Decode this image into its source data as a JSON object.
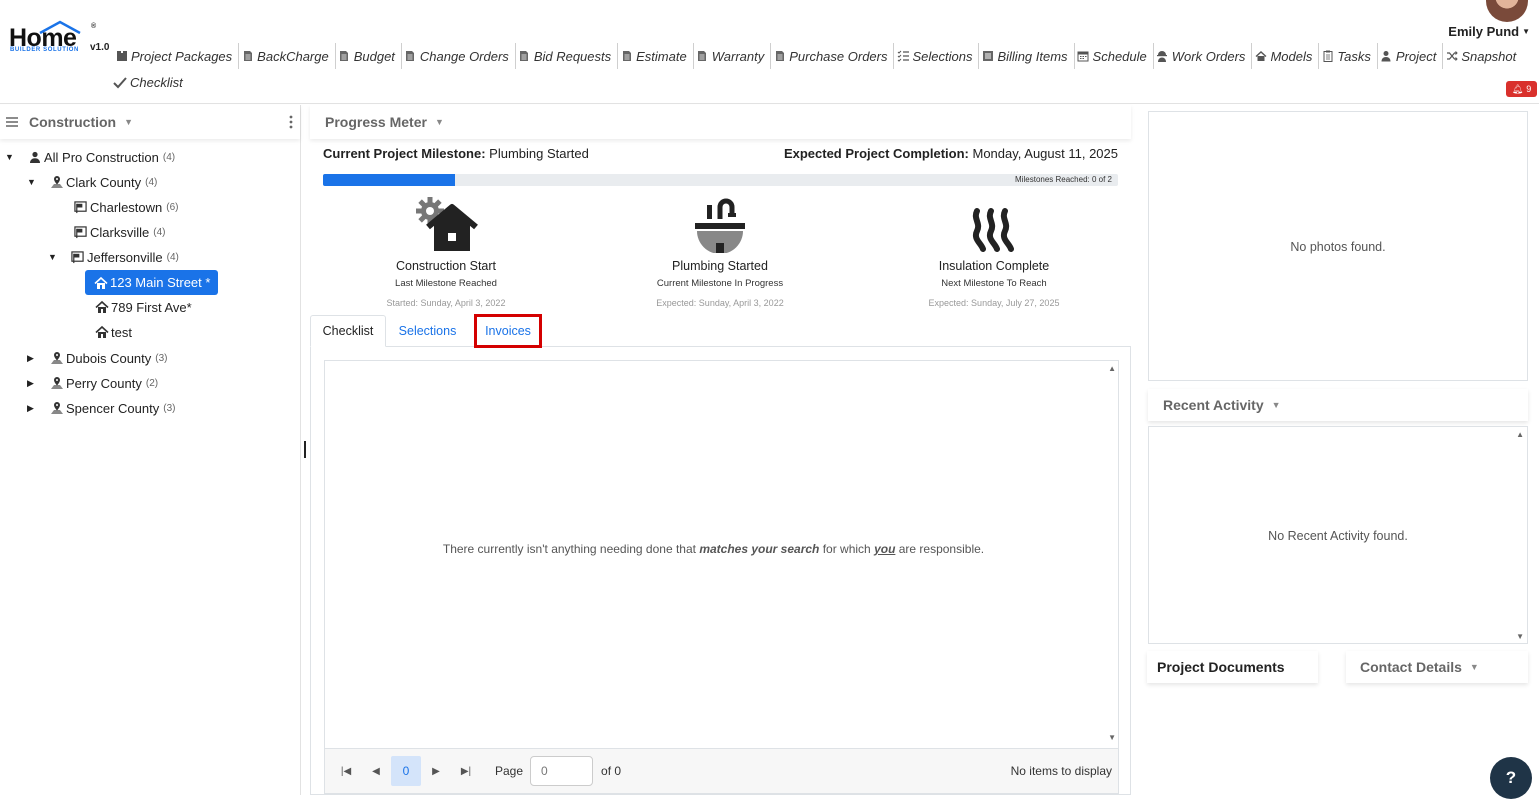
{
  "brand": {
    "logo_text": "Home",
    "tagline": "BUILDER SOLUTION",
    "version": "v1.0",
    "reg": "®"
  },
  "nav": {
    "items": [
      {
        "label": "Project Packages",
        "icon": "packages-icon"
      },
      {
        "label": "BackCharge",
        "icon": "document-icon"
      },
      {
        "label": "Budget",
        "icon": "document-icon"
      },
      {
        "label": "Change Orders",
        "icon": "document-icon"
      },
      {
        "label": "Bid Requests",
        "icon": "document-icon"
      },
      {
        "label": "Estimate",
        "icon": "document-icon"
      },
      {
        "label": "Warranty",
        "icon": "document-icon"
      },
      {
        "label": "Purchase Orders",
        "icon": "document-icon"
      },
      {
        "label": "Selections",
        "icon": "list-check-icon"
      },
      {
        "label": "Billing Items",
        "icon": "list-icon"
      },
      {
        "label": "Schedule",
        "icon": "calendar-icon"
      },
      {
        "label": "Work Orders",
        "icon": "worker-icon"
      },
      {
        "label": "Models",
        "icon": "house-icon"
      },
      {
        "label": "Tasks",
        "icon": "clipboard-icon"
      },
      {
        "label": "Project",
        "icon": "person-icon"
      },
      {
        "label": "Snapshot",
        "icon": "shuffle-icon"
      }
    ],
    "checklist": "Checklist"
  },
  "user": {
    "name": "Emily Pund",
    "notifications": "9"
  },
  "left": {
    "title": "Construction",
    "tree": [
      {
        "label": "All Pro Construction",
        "count": "(4)"
      },
      {
        "label": "Clark County",
        "count": "(4)"
      },
      {
        "label": "Charlestown",
        "count": "(6)"
      },
      {
        "label": "Clarksville",
        "count": "(4)"
      },
      {
        "label": "Jeffersonville",
        "count": "(4)"
      },
      {
        "label": "123 Main Street *",
        "count": ""
      },
      {
        "label": "789 First Ave*",
        "count": ""
      },
      {
        "label": "test",
        "count": ""
      },
      {
        "label": "Dubois County",
        "count": "(3)"
      },
      {
        "label": "Perry County",
        "count": "(2)"
      },
      {
        "label": "Spencer County",
        "count": "(3)"
      }
    ]
  },
  "progress": {
    "title": "Progress Meter",
    "current_label": "Current Project Milestone:",
    "current_value": "Plumbing Started",
    "expected_label": "Expected Project Completion:",
    "expected_value": "Monday, August 11, 2025",
    "fill_fraction": 0.166,
    "reached": "Milestones Reached: 0 of 2",
    "milestones": [
      {
        "title": "Construction Start",
        "sub": "Last Milestone Reached",
        "date": "Started: Sunday, April 3, 2022"
      },
      {
        "title": "Plumbing Started",
        "sub": "Current Milestone In Progress",
        "date": "Expected: Sunday, April 3, 2022"
      },
      {
        "title": "Insulation Complete",
        "sub": "Next Milestone To Reach",
        "date": "Expected: Sunday, July 27, 2025"
      }
    ]
  },
  "tabs": {
    "checklist": "Checklist",
    "selections": "Selections",
    "invoices": "Invoices"
  },
  "grid": {
    "empty_pre": "There currently isn't anything needing done that ",
    "empty_b": "matches your search",
    "empty_mid": " for which ",
    "empty_u": "you",
    "empty_post": " are responsible.",
    "page_label": "Page",
    "page_input": "0",
    "page_of": "of 0",
    "current_page": "0",
    "no_items": "No items to display"
  },
  "right": {
    "photos_empty": "No photos found.",
    "activity_title": "Recent Activity",
    "activity_empty": "No Recent Activity found.",
    "documents_title": "Project Documents",
    "contact_title": "Contact Details"
  },
  "help": "?",
  "colors": {
    "accent": "#1a73e8",
    "alert": "#d9302c",
    "highlight": "#d40000"
  }
}
